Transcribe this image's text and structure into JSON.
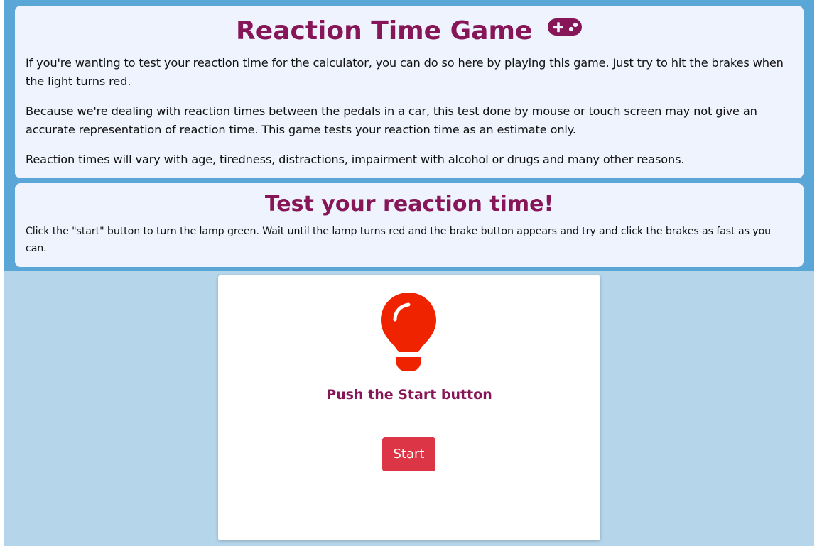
{
  "intro": {
    "title": "Reaction Time Game",
    "title_icon": "gamepad-icon",
    "paragraphs": [
      "If you're wanting to test your reaction time for the calculator, you can do so here by playing this game. Just try to hit the brakes when the light turns red.",
      "Because we're dealing with reaction times between the pedals in a car, this test done by mouse or touch screen may not give an accurate representation of reaction time. This game tests your reaction time as an estimate only.",
      "Reaction times will vary with age, tiredness, distractions, impairment with alcohol or drugs and many other reasons."
    ]
  },
  "test": {
    "title": "Test your reaction time!",
    "instructions": "Click the \"start\" button to turn the lamp green. Wait until the lamp turns red and the brake button appears and try and click the brakes as fast as you can."
  },
  "game": {
    "lamp_icon": "lightbulb-icon",
    "lamp_state": "red",
    "status": "Push the Start button",
    "start_label": "Start"
  },
  "colors": {
    "accent": "#861657",
    "band": "#5aa6d7",
    "background": "#b5d5ea",
    "card": "#eef3fe",
    "lamp_red": "#ef2300",
    "button": "#dc3545"
  }
}
